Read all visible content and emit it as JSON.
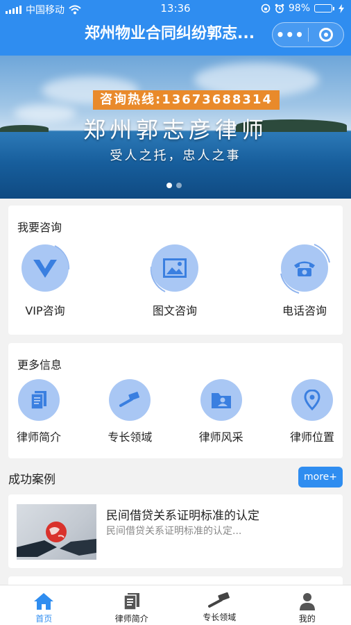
{
  "status_bar": {
    "carrier": "中国移动",
    "time": "13:36",
    "battery_pct": "98%",
    "battery_level": 0.98
  },
  "header": {
    "title": "郑州物业合同纠纷郭志...",
    "menu_icon": "more-dots-icon",
    "close_icon": "target-circle-icon"
  },
  "banner": {
    "hotline": "咨询热线:13673688314",
    "title": "郑州郭志彦律师",
    "subtitle": "受人之托，忠人之事",
    "page_count": 2,
    "active_page": 1
  },
  "consult": {
    "heading": "我要咨询",
    "items": [
      {
        "label": "VIP咨询",
        "icon": "vip-v-icon"
      },
      {
        "label": "图文咨询",
        "icon": "image-icon"
      },
      {
        "label": "电话咨询",
        "icon": "telephone-icon"
      }
    ]
  },
  "more_info": {
    "heading": "更多信息",
    "items": [
      {
        "label": "律师简介",
        "icon": "document-icon"
      },
      {
        "label": "专长领域",
        "icon": "gavel-icon"
      },
      {
        "label": "律师风采",
        "icon": "folder-person-icon"
      },
      {
        "label": "律师位置",
        "icon": "location-pin-icon"
      }
    ]
  },
  "cases": {
    "heading": "成功案例",
    "more_label": "more+",
    "items": [
      {
        "title": "民间借贷关系证明标准的认定",
        "summary": "民间借贷关系证明标准的认定..."
      }
    ]
  },
  "tabbar": {
    "items": [
      {
        "label": "首页",
        "icon": "home-icon",
        "active": true
      },
      {
        "label": "律师简介",
        "icon": "document-icon",
        "active": false
      },
      {
        "label": "专长领域",
        "icon": "gavel-icon",
        "active": false
      },
      {
        "label": "我的",
        "icon": "person-icon",
        "active": false
      }
    ]
  },
  "colors": {
    "primary": "#2f8df0",
    "icon_bg": "#a9c7f4",
    "icon_fg": "#3a7fe0",
    "hotline_bg": "#e98a2b"
  }
}
